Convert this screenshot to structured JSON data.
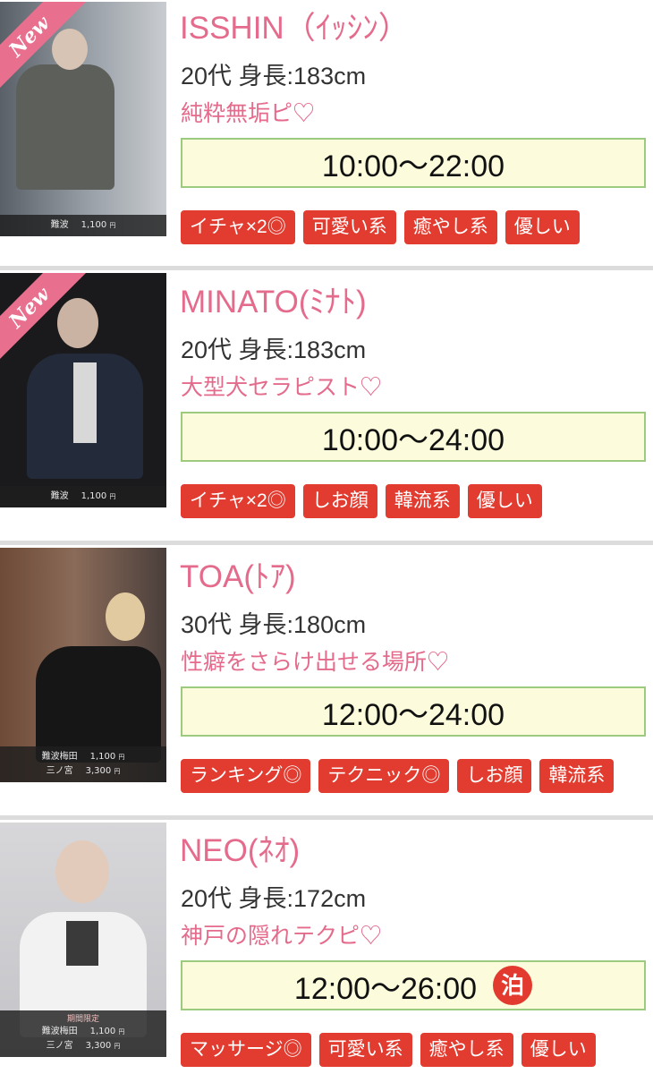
{
  "cards": [
    {
      "name": "ISSHIN（ｲｯｼﾝ）",
      "meta": "20代 身長:183cm",
      "catch": "純粋無垢ピ♡",
      "hours": "10:00〜22:00",
      "new_badge": "New",
      "price_lines": [
        {
          "area": "難波",
          "price": "1,100",
          "unit": "円"
        }
      ],
      "tags": [
        "イチャ×2◎",
        "可愛い系",
        "癒やし系",
        "優しい"
      ]
    },
    {
      "name": "MINATO(ﾐﾅﾄ)",
      "meta": "20代 身長:183cm",
      "catch": "大型犬セラピスト♡",
      "hours": "10:00〜24:00",
      "new_badge": "New",
      "price_lines": [
        {
          "area": "難波",
          "price": "1,100",
          "unit": "円"
        }
      ],
      "tags": [
        "イチャ×2◎",
        "しお顔",
        "韓流系",
        "優しい"
      ]
    },
    {
      "name": "TOA(ﾄｱ)",
      "meta": "30代 身長:180cm",
      "catch": "性癖をさらけ出せる場所♡",
      "hours": "12:00〜24:00",
      "price_lines": [
        {
          "area": "難波梅田",
          "price": "1,100",
          "unit": "円"
        },
        {
          "area": "三ノ宮",
          "price": "3,300",
          "unit": "円"
        }
      ],
      "tags": [
        "ランキング◎",
        "テクニック◎",
        "しお顔",
        "韓流系"
      ]
    },
    {
      "name": "NEO(ﾈｵ)",
      "meta": "20代 身長:172cm",
      "catch": "神戸の隠れテクピ♡",
      "hours": "12:00〜26:00",
      "stay_badge": "泊",
      "price_note": "期間限定",
      "price_lines": [
        {
          "area": "難波梅田",
          "price": "1,100",
          "unit": "円"
        },
        {
          "area": "三ノ宮",
          "price": "3,300",
          "unit": "円"
        }
      ],
      "tags": [
        "マッサージ◎",
        "可愛い系",
        "癒やし系",
        "優しい"
      ]
    }
  ]
}
